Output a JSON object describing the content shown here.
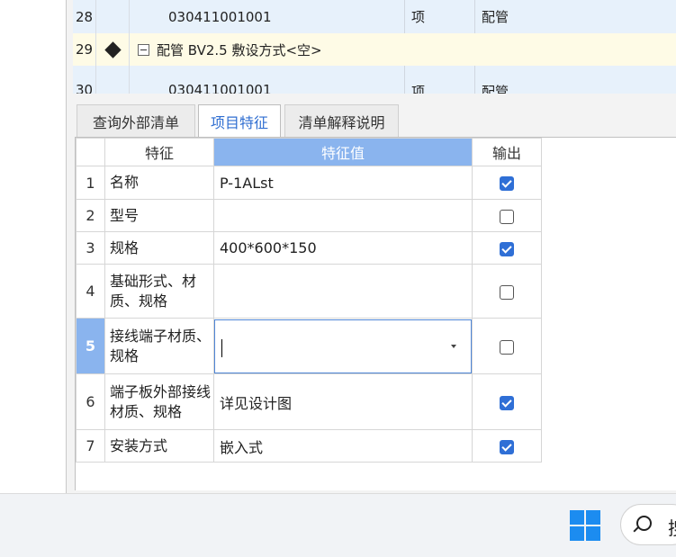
{
  "tree": {
    "rows": [
      {
        "num": "28",
        "code": "030411001001",
        "unit": "项",
        "name": "配管"
      },
      {
        "num": "29",
        "text": "配管 BV2.5 敷设方式<空>"
      },
      {
        "num": "30",
        "code": "030411001001",
        "unit": "项",
        "name": "配管"
      }
    ]
  },
  "tabs": [
    {
      "label": "查询外部清单",
      "active": false
    },
    {
      "label": "项目特征",
      "active": true
    },
    {
      "label": "清单解释说明",
      "active": false
    }
  ],
  "grid": {
    "headers": {
      "feature": "特征",
      "value": "特征值",
      "output": "输出"
    },
    "rows": [
      {
        "idx": "1",
        "feature": "名称",
        "value": "P-1ALst",
        "output": true
      },
      {
        "idx": "2",
        "feature": "型号",
        "value": "",
        "output": false
      },
      {
        "idx": "3",
        "feature": "规格",
        "value": "400*600*150",
        "output": true
      },
      {
        "idx": "4",
        "feature": "基础形式、材质、规格",
        "value": "",
        "output": false
      },
      {
        "idx": "5",
        "feature": "接线端子材质、规格",
        "value": "",
        "output": false,
        "editing": true
      },
      {
        "idx": "6",
        "feature": "端子板外部接线材质、规格",
        "value": "详见设计图",
        "output": true
      },
      {
        "idx": "7",
        "feature": "安装方式",
        "value": "嵌入式",
        "output": true
      }
    ]
  },
  "taskbar": {
    "search_text": "搜"
  },
  "colors": {
    "accent": "#2f6fd6",
    "header_highlight": "#8ab4ee",
    "tree_row_bg": "#e7f1fb",
    "tree_group_bg": "#fefbe6",
    "windows_blue": "#1c8cf0"
  }
}
